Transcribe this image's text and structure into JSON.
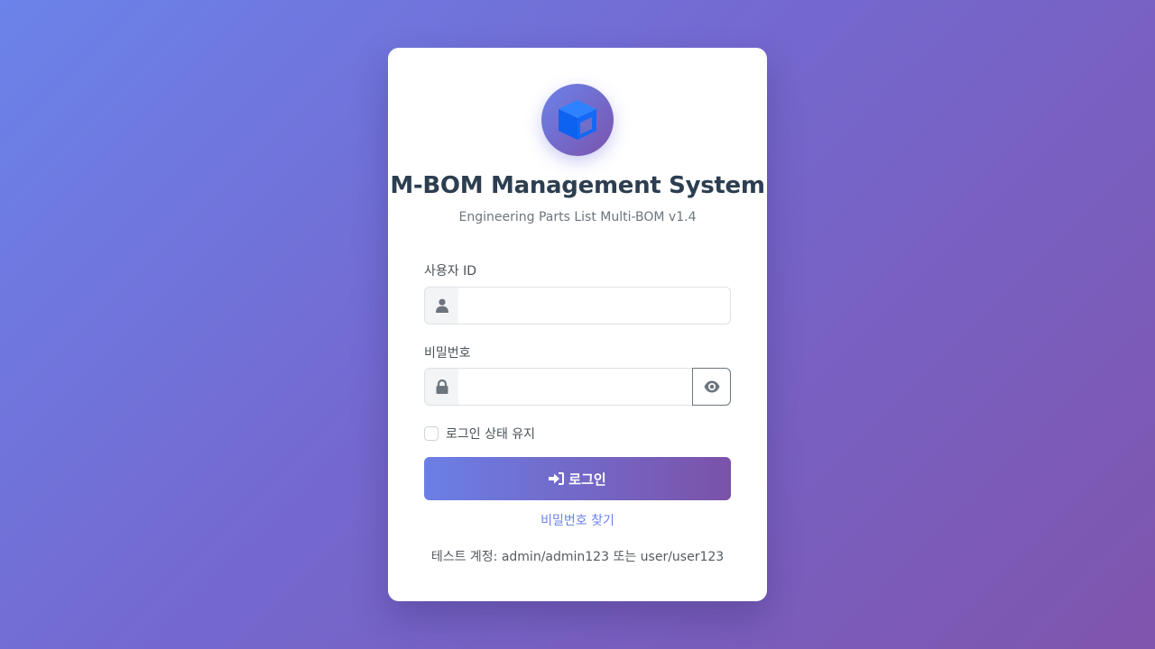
{
  "app": {
    "title": "M-BOM Management System",
    "subtitle": "Engineering Parts List Multi-BOM v1.4",
    "logo_icon": "cube-icon"
  },
  "form": {
    "user_id": {
      "label": "사용자 ID",
      "value": "",
      "placeholder": "",
      "icon": "user-icon"
    },
    "password": {
      "label": "비밀번호",
      "value": "",
      "placeholder": "",
      "icon": "lock-icon",
      "toggle_icon": "eye-icon"
    },
    "remember": {
      "label": "로그인 상태 유지",
      "checked": false
    },
    "submit": {
      "label": "로그인",
      "icon": "sign-in-icon"
    },
    "forgot_password": "비밀번호 찾기",
    "test_accounts": "테스트 계정: admin/admin123 또는 user/user123"
  },
  "colors": {
    "gradient_start": "#6b83ea",
    "gradient_end": "#7f55ad",
    "title": "#2c3e50",
    "link": "#6b82e8",
    "logo_cube": "#1668f5"
  }
}
